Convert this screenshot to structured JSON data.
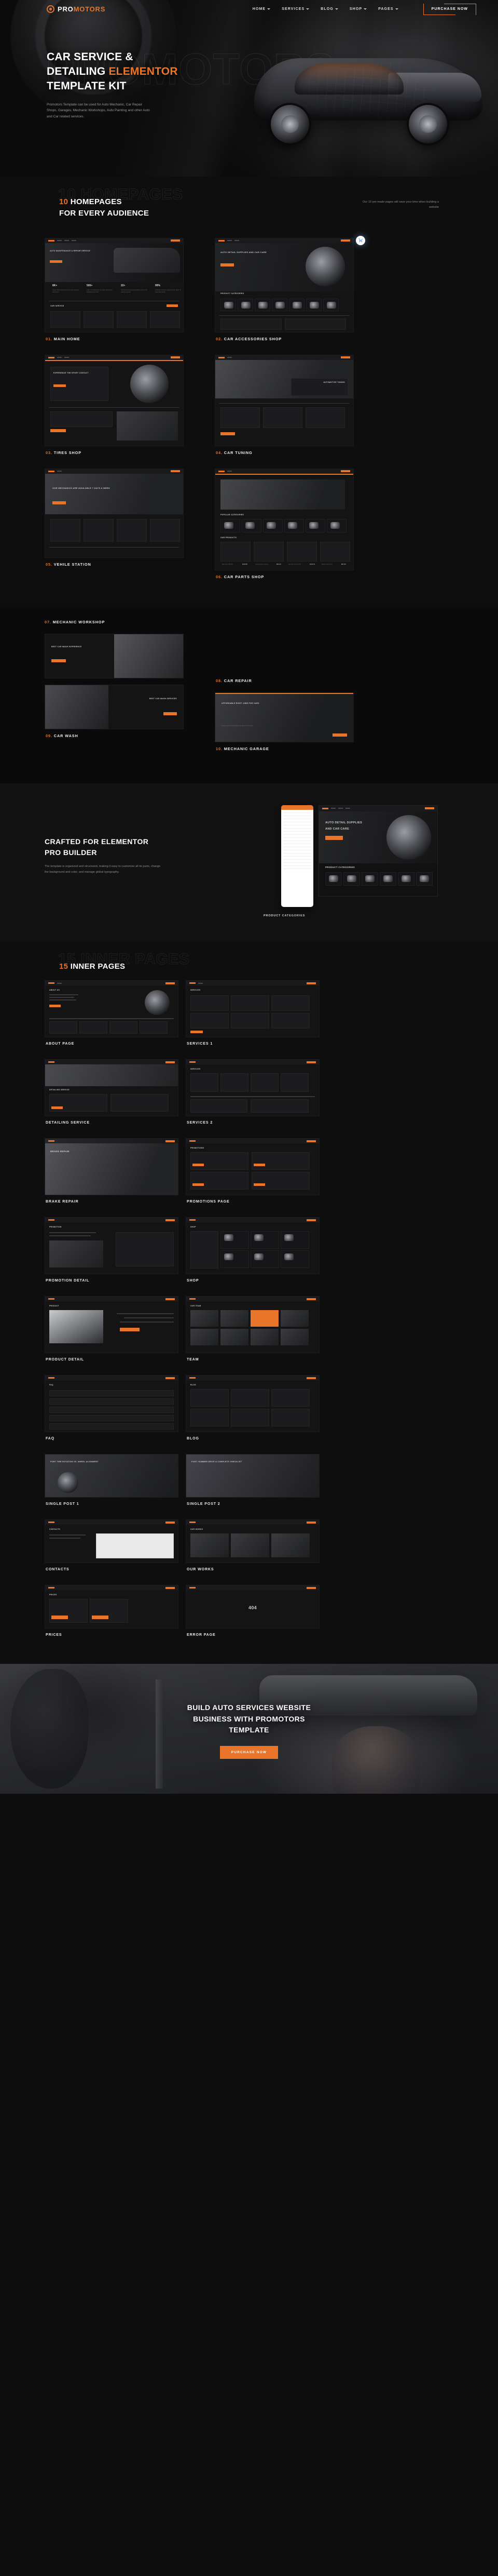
{
  "header": {
    "logo": {
      "pro": "PRO",
      "motors": "MOTORS"
    },
    "nav": [
      {
        "label": "HOME"
      },
      {
        "label": "SERVICES"
      },
      {
        "label": "BLOG"
      },
      {
        "label": "SHOP"
      },
      {
        "label": "PAGES"
      }
    ],
    "purchase_label": "PURCHASE NOW"
  },
  "hero": {
    "watermark": "PROMOTORS",
    "title_line1": "CAR SERVICE &",
    "title_line2_white": "DETAILING ",
    "title_line2_accent": "ELEMENTOR",
    "title_line3": "TEMPLATE KIT",
    "subtitle": "Promotors Template can be used for Auto Mechanic, Car Repair Shops, Garages, Mechanic Workshops, Auto Painting and other Auto and Car related services."
  },
  "homepages": {
    "ghost": "10 HOMEPAGES",
    "count": "10",
    "heading_rest": " HOMEPAGES",
    "heading_line2": "FOR EVERY AUDIENCE",
    "note": "Our 10 pre-made pages will save your time when building a website",
    "items": [
      {
        "num": "01.",
        "label": "MAIN HOME",
        "hero_title": "AUTO MAINTENANCE & REPAIR SERVICE",
        "cta": "READ MORE",
        "section_title": "OUR SERVICE",
        "stats": [
          "8K+",
          "500+",
          "22+",
          "99%"
        ]
      },
      {
        "num": "02.",
        "label": "CAR ACCESSORIES SHOP",
        "hero_title": "AUTO DETAIL SUPPLIES AND CAR CARE",
        "cta": "SHOP NOW",
        "section_title": "PRODUCT CATEGORIES"
      },
      {
        "num": "03.",
        "label": "TIRES SHOP",
        "hero_title": "EXPERIENCE THE SPORT CONTACT",
        "cta": "BUY NOW"
      },
      {
        "num": "04.",
        "label": "CAR TUNING",
        "hero_title": "AUTOMOTIVE TUNING",
        "cta": "LEARN MORE"
      },
      {
        "num": "05.",
        "label": "VEHILE STATION",
        "hero_title": "OUR MECHANICS ARE AVAILABLE 7 DAYS A WEEK",
        "cta": "BOOK NOW"
      },
      {
        "num": "06.",
        "label": "CAR PARTS SHOP",
        "hero_title": "POPULAR CATEGORIES",
        "section_title": "OUR PRODUCTS",
        "products": [
          {
            "name": "Ball Joint JBJ721",
            "price": "$118.80"
          },
          {
            "name": "Compression Spring",
            "price": "$60.20",
            "old": "$90.10"
          },
          {
            "name": "Dia Auto Ferrari F8",
            "price": "$123.91"
          },
          {
            "name": "Brake Disc Front",
            "price": "$61.99"
          }
        ]
      },
      {
        "num": "07.",
        "label": "MECHANIC WORKSHOP",
        "hero_title": "MECHANIC WORKSHOP"
      },
      {
        "num": "08.",
        "label": "CAR REPAIR",
        "hero_title": "BEST CAR WASH EXPERIENCE",
        "cta": "READ MORE"
      },
      {
        "num": "09.",
        "label": "CAR WASH",
        "hero_title": "BEST CAR WASH SERVICES",
        "cta": "GET STARTED"
      },
      {
        "num": "10.",
        "label": "MECHANIC GARAGE",
        "hero_title": "AFFORDABLE RIGHT JOBS FOR CARS",
        "cta": "MAKE CAR MAINTENANCE THE BEST SOLUTION"
      }
    ]
  },
  "crafted": {
    "title_line1": "CRAFTED FOR ELEMENTOR",
    "title_line2": "PRO BUILDER",
    "paragraph": "The template is organized and structured, making it easy to customize all its parts, change the background and color, and manage global typography.",
    "preview_title_1": "AUTO DETAIL SUPPLIES",
    "preview_title_2": "AND CAR CARE",
    "preview_cta": "SHOP NOW",
    "preview_caption": "PRODUCT CATEGORIES"
  },
  "innerpages": {
    "ghost": "15 INNER PAGES",
    "count": "15",
    "heading_rest": " INNER PAGES",
    "items": [
      {
        "label": "ABOUT PAGE",
        "mini_title": "ABOUT US"
      },
      {
        "label": "SERVICES 1",
        "mini_title": "SERVICES"
      },
      {
        "label": "DETAILING SERVICE",
        "mini_title": "DETAILING SERVICE"
      },
      {
        "label": "SERVICES 2",
        "mini_title": "SERVICES"
      },
      {
        "label": "BRAKE REPAIR",
        "mini_title": "BRAKE REPAIR"
      },
      {
        "label": "PROMOTIONS PAGE",
        "mini_title": "PROMOTIONS"
      },
      {
        "label": "PROMOTION DETAIL",
        "mini_title": "PROMOTION"
      },
      {
        "label": "SHOP",
        "mini_title": "SHOP"
      },
      {
        "label": "PRODUCT DETAIL",
        "mini_title": "PRODUCT"
      },
      {
        "label": "TEAM",
        "mini_title": "OUR TEAM"
      },
      {
        "label": "FAQ",
        "mini_title": "FAQ"
      },
      {
        "label": "BLOG",
        "mini_title": "BLOG"
      },
      {
        "label": "SINGLE POST 1",
        "mini_title": "PORT TIRE ROTATION VS. WHEEL ALIGNMENT"
      },
      {
        "label": "SINGLE POST 2",
        "mini_title": "POST: SUMMER DRIVE & COMPLETE CHECKLIST"
      },
      {
        "label": "CONTACTS",
        "mini_title": "CONTACTS"
      },
      {
        "label": "OUR WORKS",
        "mini_title": "OUR WORKS"
      },
      {
        "label": "PRICES",
        "mini_title": "PRICES"
      },
      {
        "label": "ERROR PAGE",
        "mini_title": "404"
      }
    ]
  },
  "cta": {
    "line1": "BUILD AUTO SERVICES WEBSITE",
    "line2": "BUSINESS WITH PROMOTORS",
    "line3": "TEMPLATE",
    "button": "PURCHASE NOW"
  },
  "colors": {
    "accent": "#e8752a",
    "bg": "#0d0d0d",
    "panel": "#141415"
  }
}
